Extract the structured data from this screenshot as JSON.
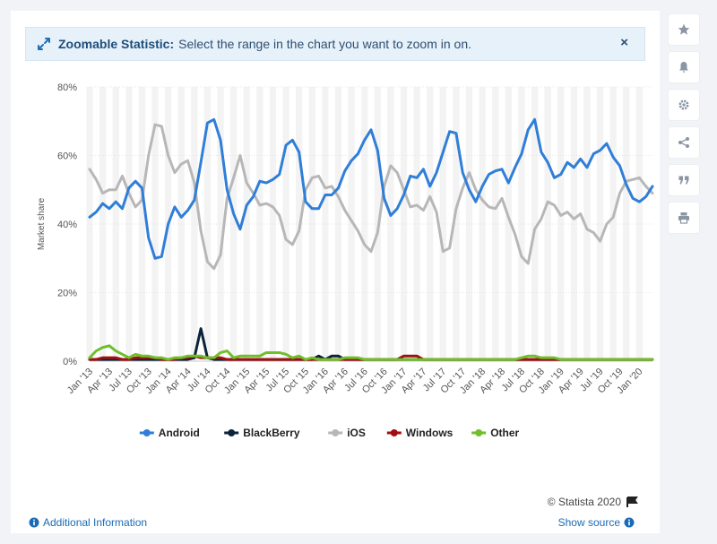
{
  "banner": {
    "title": "Zoomable Statistic:",
    "message": "Select the range in the chart you want to zoom in on.",
    "close_label": "×"
  },
  "footer": {
    "credit": "© Statista 2020",
    "additional_info": "Additional Information",
    "show_source": "Show source"
  },
  "sidebar": {
    "icons": [
      "star-icon",
      "bell-icon",
      "gear-icon",
      "share-icon",
      "quote-icon",
      "print-icon"
    ]
  },
  "chart_data": {
    "type": "line",
    "title": "",
    "xlabel": "",
    "ylabel": "Market share",
    "ylim": [
      0,
      80
    ],
    "y_ticks": [
      "0%",
      "20%",
      "40%",
      "60%",
      "80%"
    ],
    "x_tick_labels": [
      "Jan '13",
      "Apr '13",
      "Jul '13",
      "Oct '13",
      "Jan '14",
      "Apr '14",
      "Jul '14",
      "Oct '14",
      "Jan '15",
      "Apr '15",
      "Jul '15",
      "Oct '15",
      "Jan '16",
      "Apr '16",
      "Jul '16",
      "Oct '16",
      "Jan '17",
      "Apr '17",
      "Jul '17",
      "Oct '17",
      "Jan '18",
      "Apr '18",
      "Jul '18",
      "Oct '18",
      "Jan '19",
      "Apr '19",
      "Jul '19",
      "Oct '19",
      "Jan '20"
    ],
    "legend_position": "bottom",
    "grid": true,
    "colors": {
      "Android": "#2f7ed8",
      "BlackBerry": "#0d233a",
      "iOS": "#b7b7b7",
      "Windows": "#a01010",
      "Other": "#6fbf2a"
    },
    "series": [
      {
        "name": "Android",
        "values": [
          42,
          43.5,
          46,
          44.5,
          46.5,
          44.5,
          50.5,
          52.5,
          50.5,
          36,
          30,
          30.5,
          40,
          45,
          42,
          44,
          47,
          58,
          69.5,
          70.5,
          64.5,
          50,
          43,
          38.5,
          45.5,
          48,
          52.5,
          52,
          53,
          54.5,
          63,
          64.5,
          61,
          46.5,
          44.5,
          44.5,
          48.5,
          48.5,
          50.5,
          55.5,
          58.5,
          60.5,
          64.5,
          67.5,
          61.5,
          47.5,
          42.5,
          44.5,
          48.5,
          54,
          53.5,
          56,
          51,
          55,
          61,
          67,
          66.5,
          55,
          50,
          46.5,
          51,
          54.5,
          55.5,
          56,
          52,
          56.5,
          60.5,
          67.5,
          70.5,
          61,
          58,
          53.5,
          54.5,
          58,
          56.5,
          59,
          56.5,
          60.5,
          61.5,
          63.5,
          59.5,
          57,
          51.5,
          47.5,
          46.5,
          48,
          51
        ]
      },
      {
        "name": "BlackBerry",
        "values": [
          0.5,
          0.5,
          0.5,
          0.5,
          0.5,
          0.5,
          0.5,
          0.5,
          0.5,
          0.5,
          0.5,
          0.5,
          0.5,
          0.5,
          0.5,
          0.5,
          1,
          9.5,
          1,
          0.5,
          0.5,
          0.5,
          0.5,
          0.5,
          0.5,
          0.5,
          0.5,
          0.5,
          0.5,
          0.5,
          0.5,
          0.5,
          0.5,
          0.5,
          0.5,
          1.5,
          0.5,
          1.5,
          1.5,
          0.5,
          0.5,
          0.5,
          0.5,
          0.5,
          0.5,
          0.5,
          0.5,
          0.5,
          0.5,
          0.5,
          0.5,
          0.5,
          0.5,
          0.5,
          0.5,
          0.5,
          0.5,
          0.5,
          0.5,
          0.5,
          0.5,
          0.5,
          0.5,
          0.5,
          0.5,
          0.5,
          0.5,
          0.5,
          0.5,
          0.5,
          0.5,
          0.5,
          0.5,
          0.5,
          0.5,
          0.5,
          0.5,
          0.5,
          0.5,
          0.5,
          0.5,
          0.5,
          0.5,
          0.5,
          0.5,
          0.5,
          0.5
        ]
      },
      {
        "name": "iOS",
        "values": [
          56,
          53,
          49,
          50,
          50,
          54,
          49,
          45,
          47,
          60,
          69,
          68.5,
          60,
          55,
          57.5,
          58.5,
          52,
          38,
          29,
          27,
          31,
          47.5,
          53.5,
          60,
          52,
          49,
          45.5,
          46,
          45,
          42.5,
          35.5,
          34,
          38,
          50,
          53.5,
          54,
          50.5,
          51,
          48,
          44,
          41,
          38,
          34,
          32,
          37.5,
          51,
          57,
          55,
          50,
          45,
          45.5,
          44,
          48,
          43.5,
          32,
          33,
          44.5,
          50.5,
          55,
          50,
          47,
          45,
          44.5,
          47.5,
          42,
          37,
          30.5,
          28.5,
          38.5,
          41.5,
          46.5,
          45.5,
          42.5,
          43.5,
          41.5,
          43,
          38.5,
          37.5,
          35,
          40,
          42,
          49,
          52.5,
          53,
          53.5,
          51,
          49
        ]
      },
      {
        "name": "Windows",
        "values": [
          0.5,
          0.5,
          1,
          1,
          1,
          0.5,
          0.5,
          1,
          1,
          1,
          1,
          0.5,
          0.5,
          0.5,
          1,
          1,
          1.5,
          1,
          1,
          1,
          1,
          0.5,
          0.5,
          0.5,
          0.5,
          0.5,
          0.5,
          0.5,
          0.5,
          0.5,
          0.5,
          0.5,
          0.5,
          0.5,
          0.5,
          0.5,
          0.5,
          0.5,
          0.5,
          0.5,
          0.5,
          0.5,
          0.5,
          0.5,
          0.5,
          0.5,
          0.5,
          0.5,
          1.5,
          1.5,
          1.5,
          0.5,
          0.5,
          0.5,
          0.5,
          0.5,
          0.5,
          0.5,
          0.5,
          0.5,
          0.5,
          0.5,
          0.5,
          0.5,
          0.5,
          0.5,
          0.5,
          0.5,
          0.5,
          0.5,
          0.5,
          0.5,
          0.5,
          0.5,
          0.5,
          0.5,
          0.5,
          0.5,
          0.5,
          0.5,
          0.5,
          0.5,
          0.5,
          0.5,
          0.5,
          0.5,
          0.5
        ]
      },
      {
        "name": "Other",
        "values": [
          1,
          3,
          4,
          4.5,
          3,
          2,
          1,
          2,
          1.5,
          1.5,
          1,
          1,
          0.5,
          1,
          1,
          1.5,
          1.5,
          1.5,
          1,
          1,
          2.5,
          3,
          1,
          1.5,
          1.5,
          1.5,
          1.5,
          2.5,
          2.5,
          2.5,
          2,
          1,
          1.5,
          0.5,
          1,
          0.5,
          0.5,
          0.5,
          0.5,
          1,
          1,
          1,
          0.5,
          0.5,
          0.5,
          0.5,
          0.5,
          0.5,
          0.5,
          0.5,
          0.5,
          0.5,
          0.5,
          0.5,
          0.5,
          0.5,
          0.5,
          0.5,
          0.5,
          0.5,
          0.5,
          0.5,
          0.5,
          0.5,
          0.5,
          0.5,
          1,
          1.5,
          1.5,
          1,
          1,
          1,
          0.5,
          0.5,
          0.5,
          0.5,
          0.5,
          0.5,
          0.5,
          0.5,
          0.5,
          0.5,
          0.5,
          0.5,
          0.5,
          0.5,
          0.5
        ]
      }
    ]
  }
}
